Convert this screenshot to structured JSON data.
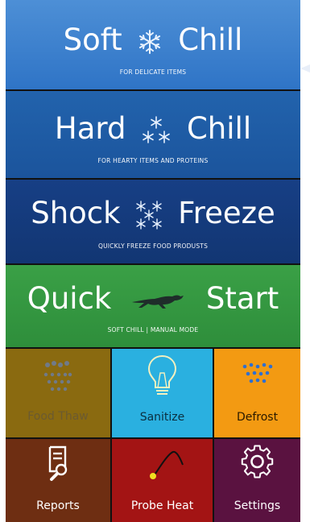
{
  "modes": [
    {
      "title_left": "Soft",
      "title_right": "Chill",
      "subtitle": "FOR DELICATE ITEMS",
      "icon": "snowflake-icon"
    },
    {
      "title_left": "Hard",
      "title_right": "Chill",
      "subtitle": "FOR HEARTY ITEMS AND PROTEINS",
      "icon": "snowflakes-icon"
    },
    {
      "title_left": "Shock",
      "title_right": "Freeze",
      "subtitle": "QUICKLY FREEZE FOOD PRODUSTS",
      "icon": "snowflake-cluster-icon"
    },
    {
      "title_left": "Quick",
      "title_right": "Start",
      "subtitle": "SOFT CHILL | MANUAL MODE",
      "icon": "greyhound-icon"
    }
  ],
  "tiles": [
    {
      "label": "Food Thaw",
      "icon": "thaw-icon",
      "color": "#8a6a10",
      "disabled": true
    },
    {
      "label": "Sanitize",
      "icon": "lightbulb-icon",
      "color": "#2ab0e0"
    },
    {
      "label": "Defrost",
      "icon": "droplets-icon",
      "color": "#f39a12"
    },
    {
      "label": "Reports",
      "icon": "report-search-icon",
      "color": "#6e2e12"
    },
    {
      "label": "Probe Heat",
      "icon": "probe-icon",
      "color": "#a31414"
    },
    {
      "label": "Settings",
      "icon": "gear-icon",
      "color": "#5a1240"
    }
  ]
}
